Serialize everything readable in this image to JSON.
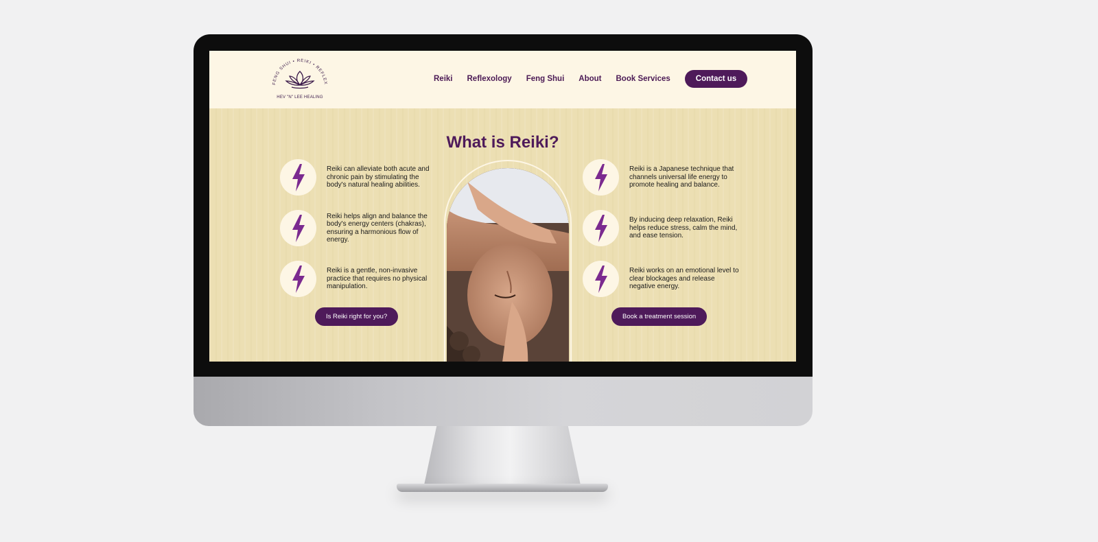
{
  "logo": {
    "arc_text": "FENG SHUI • REIKI • REFLEXOLOGY",
    "caption": "HEV \"N\" LEE HEALING"
  },
  "nav": {
    "items": [
      "Reiki",
      "Reflexology",
      "Feng Shui",
      "About",
      "Book Services"
    ],
    "contact": "Contact us"
  },
  "main": {
    "title": "What is Reiki?",
    "left_features": [
      "Reiki can alleviate both acute and chronic pain by stimulating the body's natural healing abilities.",
      "Reiki helps align and balance the body's energy centers (chakras), ensuring a harmonious flow of energy.",
      "Reiki is a gentle, non-invasive practice that requires no physical manipulation."
    ],
    "right_features": [
      "Reiki is a Japanese technique that channels universal life energy to promote healing and balance.",
      "By inducing deep relaxation, Reiki helps reduce stress, calm the mind, and ease tension.",
      "Reiki works on an emotional level to clear blockages and release negative energy."
    ],
    "left_cta": "Is Reiki right for you?",
    "right_cta": "Book a treatment session"
  },
  "colors": {
    "brand_purple": "#4e1a5a",
    "icon_purple": "#7b2a8f",
    "cream": "#fdf6e5",
    "sand": "#ecdfb3"
  },
  "icons": {
    "feature": "lightning-bolt-icon",
    "logo": "lotus-icon"
  }
}
